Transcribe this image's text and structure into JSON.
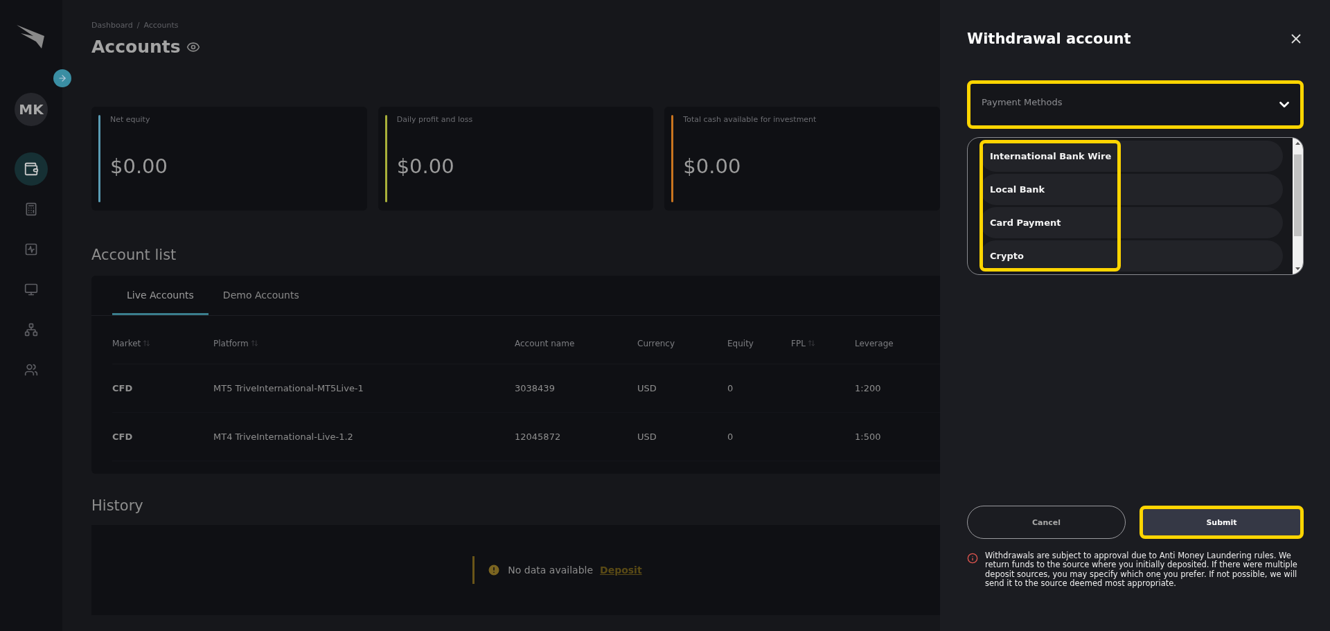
{
  "sidebar": {
    "avatar": "MK",
    "items": [
      {
        "kind": "wallet",
        "selected": true
      },
      {
        "kind": "calculator",
        "selected": false
      },
      {
        "kind": "chart",
        "selected": false
      },
      {
        "kind": "monitor",
        "selected": false
      },
      {
        "kind": "network",
        "selected": false
      },
      {
        "kind": "people",
        "selected": false
      }
    ]
  },
  "breadcrumb": {
    "items": [
      "Dashboard",
      "Accounts"
    ],
    "separator": "/"
  },
  "page_title": "Accounts",
  "summary_cards": [
    {
      "label": "Net equity",
      "value": "$0.00",
      "color": "#5a9cb4"
    },
    {
      "label": "Daily profit and loss",
      "value": "$0.00",
      "color": "#a8b03a"
    },
    {
      "label": "Total cash available for investment",
      "value": "$0.00",
      "color": "#c9741f"
    }
  ],
  "account_list": {
    "title": "Account list",
    "tabs": [
      {
        "label": "Live Accounts",
        "selected": true
      },
      {
        "label": "Demo Accounts",
        "selected": false
      }
    ],
    "columns": [
      {
        "label": "Market",
        "sortable": true
      },
      {
        "label": "Platform",
        "sortable": true
      },
      {
        "label": "Account name",
        "sortable": false
      },
      {
        "label": "Currency",
        "sortable": false
      },
      {
        "label": "Equity",
        "sortable": false
      },
      {
        "label": "FPL",
        "sortable": true
      },
      {
        "label": "Leverage",
        "sortable": false
      }
    ],
    "rows": [
      [
        "CFD",
        "MT5 TriveInternational-MT5Live-1",
        "3038439",
        "USD",
        "0",
        "",
        "1:200"
      ],
      [
        "CFD",
        "MT4 TriveInternational-Live-1.2",
        "12045872",
        "USD",
        "0",
        "",
        "1:500"
      ]
    ]
  },
  "history": {
    "title": "History",
    "empty_text": "No data available",
    "link": "Deposit"
  },
  "drawer": {
    "title": "Withdrawal account",
    "select": {
      "placeholder": "Payment Methods",
      "highlighted": true
    },
    "options": {
      "highlighted": true,
      "items": [
        "International Bank Wire",
        "Local Bank",
        "Card Payment",
        "Crypto"
      ]
    },
    "buttons": [
      {
        "label": "Cancel",
        "kind": "secondary",
        "highlighted": false
      },
      {
        "label": "Submit",
        "kind": "primary",
        "highlighted": true
      }
    ],
    "notice": "Withdrawals are subject to approval due to Anti Money Laundering rules. We return funds to the source where you initially deposited. If there were multiple deposit sources, you may specify which one you prefer. If not possible, we will send it to the source deemed most appropriate."
  }
}
